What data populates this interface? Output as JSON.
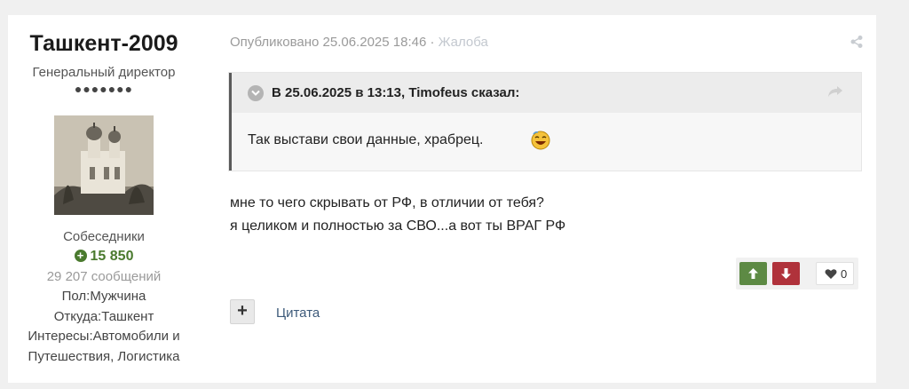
{
  "author": {
    "name": "Ташкент-2009",
    "title": "Генеральный директор",
    "rank_dots": "●●●●●●●",
    "group": "Собеседники",
    "reputation": "15 850",
    "posts": "29 207 сообщений",
    "gender": "Пол:Мужчина",
    "location": "Откуда:Ташкент",
    "interests_line1": "Интересы:Автомобили и",
    "interests_line2": "Путешествия, Логистика"
  },
  "meta": {
    "published": "Опубликовано 25.06.2025 18:46",
    "separator": " · ",
    "report": "Жалоба"
  },
  "quote": {
    "title": "В 25.06.2025 в 13:13, Timofeus сказал:",
    "text": "Так выстави свои данные, храбрец."
  },
  "content": {
    "line1": "мне то чего скрывать от РФ, в отличии от тебя?",
    "line2": "я целиком и полностью за СВО...а вот ты ВРАГ РФ"
  },
  "reactions": {
    "like_count": "0"
  },
  "actions": {
    "multiquote": "+",
    "quote": "Цитата"
  },
  "colors": {
    "reputation_green": "#4a7a2e",
    "vote_up": "#5d8a44",
    "vote_down": "#b0323b",
    "link": "#3d5a7a"
  },
  "icons": [
    "share-icon",
    "chevron-down-icon",
    "reply-arrow-icon",
    "arrow-up-icon",
    "arrow-down-icon",
    "heart-icon",
    "laughing-emoji"
  ]
}
